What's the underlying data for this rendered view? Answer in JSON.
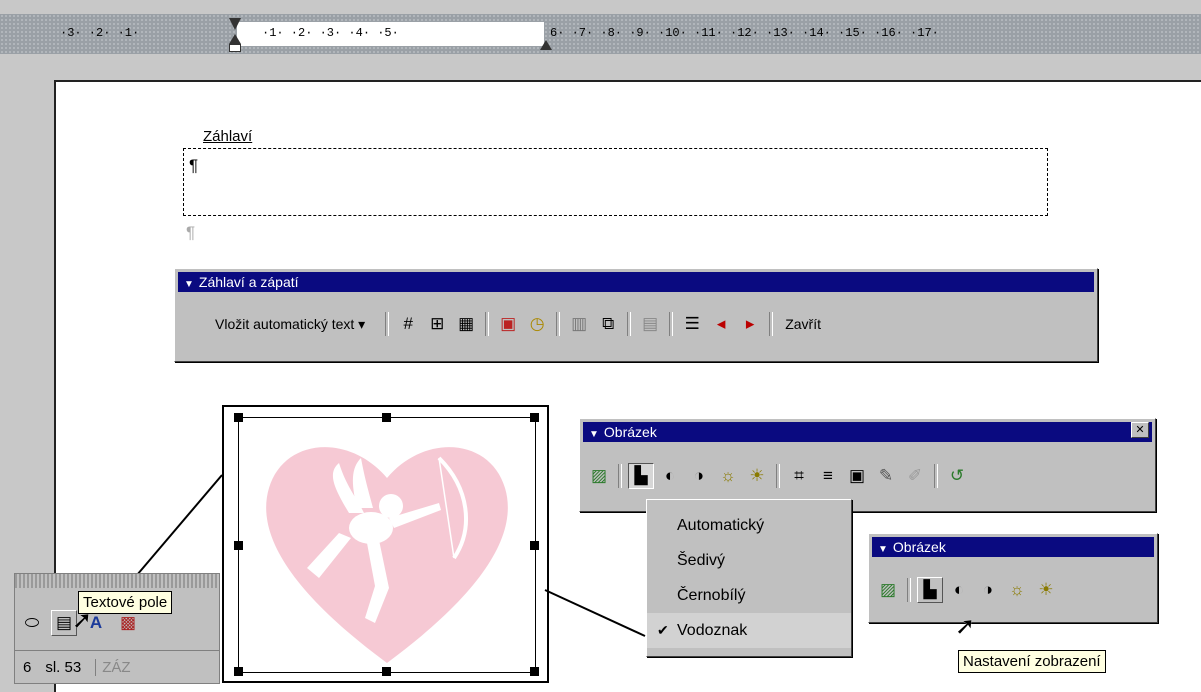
{
  "ruler": {
    "left_marks": "·3·  ·2·  ·1·",
    "mid_marks": "·1· ·2· ·3· ·4· ·5·",
    "right_marks": "6·  ·7·  ·8·  ·9·  ·10·  ·11·  ·12·  ·13·  ·14·  ·15·  ·16·  ·17·"
  },
  "header": {
    "label": "Záhlaví",
    "pilcrow": "¶"
  },
  "hf_toolbar": {
    "title": "Záhlaví a zápatí",
    "autotext_label": "Vložit automatický text ▾",
    "close_label": "Zavřít",
    "icons": [
      "page-number-icon",
      "page-count-icon",
      "format-page-number-icon",
      "insert-date-icon",
      "insert-time-icon",
      "page-setup-icon",
      "show-document-icon",
      "same-as-previous-icon",
      "switch-header-footer-icon",
      "show-previous-icon",
      "show-next-icon"
    ]
  },
  "picture_toolbar_main": {
    "title": "Obrázek",
    "close_glyph": "✕",
    "icons": [
      "insert-picture-icon",
      "image-control-icon",
      "more-contrast-icon",
      "less-contrast-icon",
      "more-brightness-icon",
      "less-brightness-icon",
      "crop-icon",
      "line-style-icon",
      "text-wrapping-icon",
      "format-picture-icon",
      "set-transparent-color-icon",
      "reset-picture-icon"
    ]
  },
  "image_control_menu": {
    "items": [
      {
        "label": "Automatický",
        "checked": false
      },
      {
        "label": "Šedivý",
        "checked": false
      },
      {
        "label": "Černobílý",
        "checked": false
      },
      {
        "label": "Vodoznak",
        "checked": true
      }
    ]
  },
  "picture_toolbar_small": {
    "title": "Obrázek",
    "icons": [
      "insert-picture-icon",
      "image-control-icon",
      "more-contrast-icon",
      "less-contrast-icon",
      "more-brightness-icon",
      "less-brightness-icon"
    ]
  },
  "tooltips": {
    "text_box": "Textové pole",
    "image_control": "Nastavení zobrazení"
  },
  "status_bar": {
    "page": "6",
    "section": "sl. 53",
    "truncated": "ZÁZ"
  },
  "colors": {
    "title_bar": "#0a0a80",
    "watermark_pink": "#f6c9d4",
    "toolbar_face": "#c0c0c0"
  }
}
